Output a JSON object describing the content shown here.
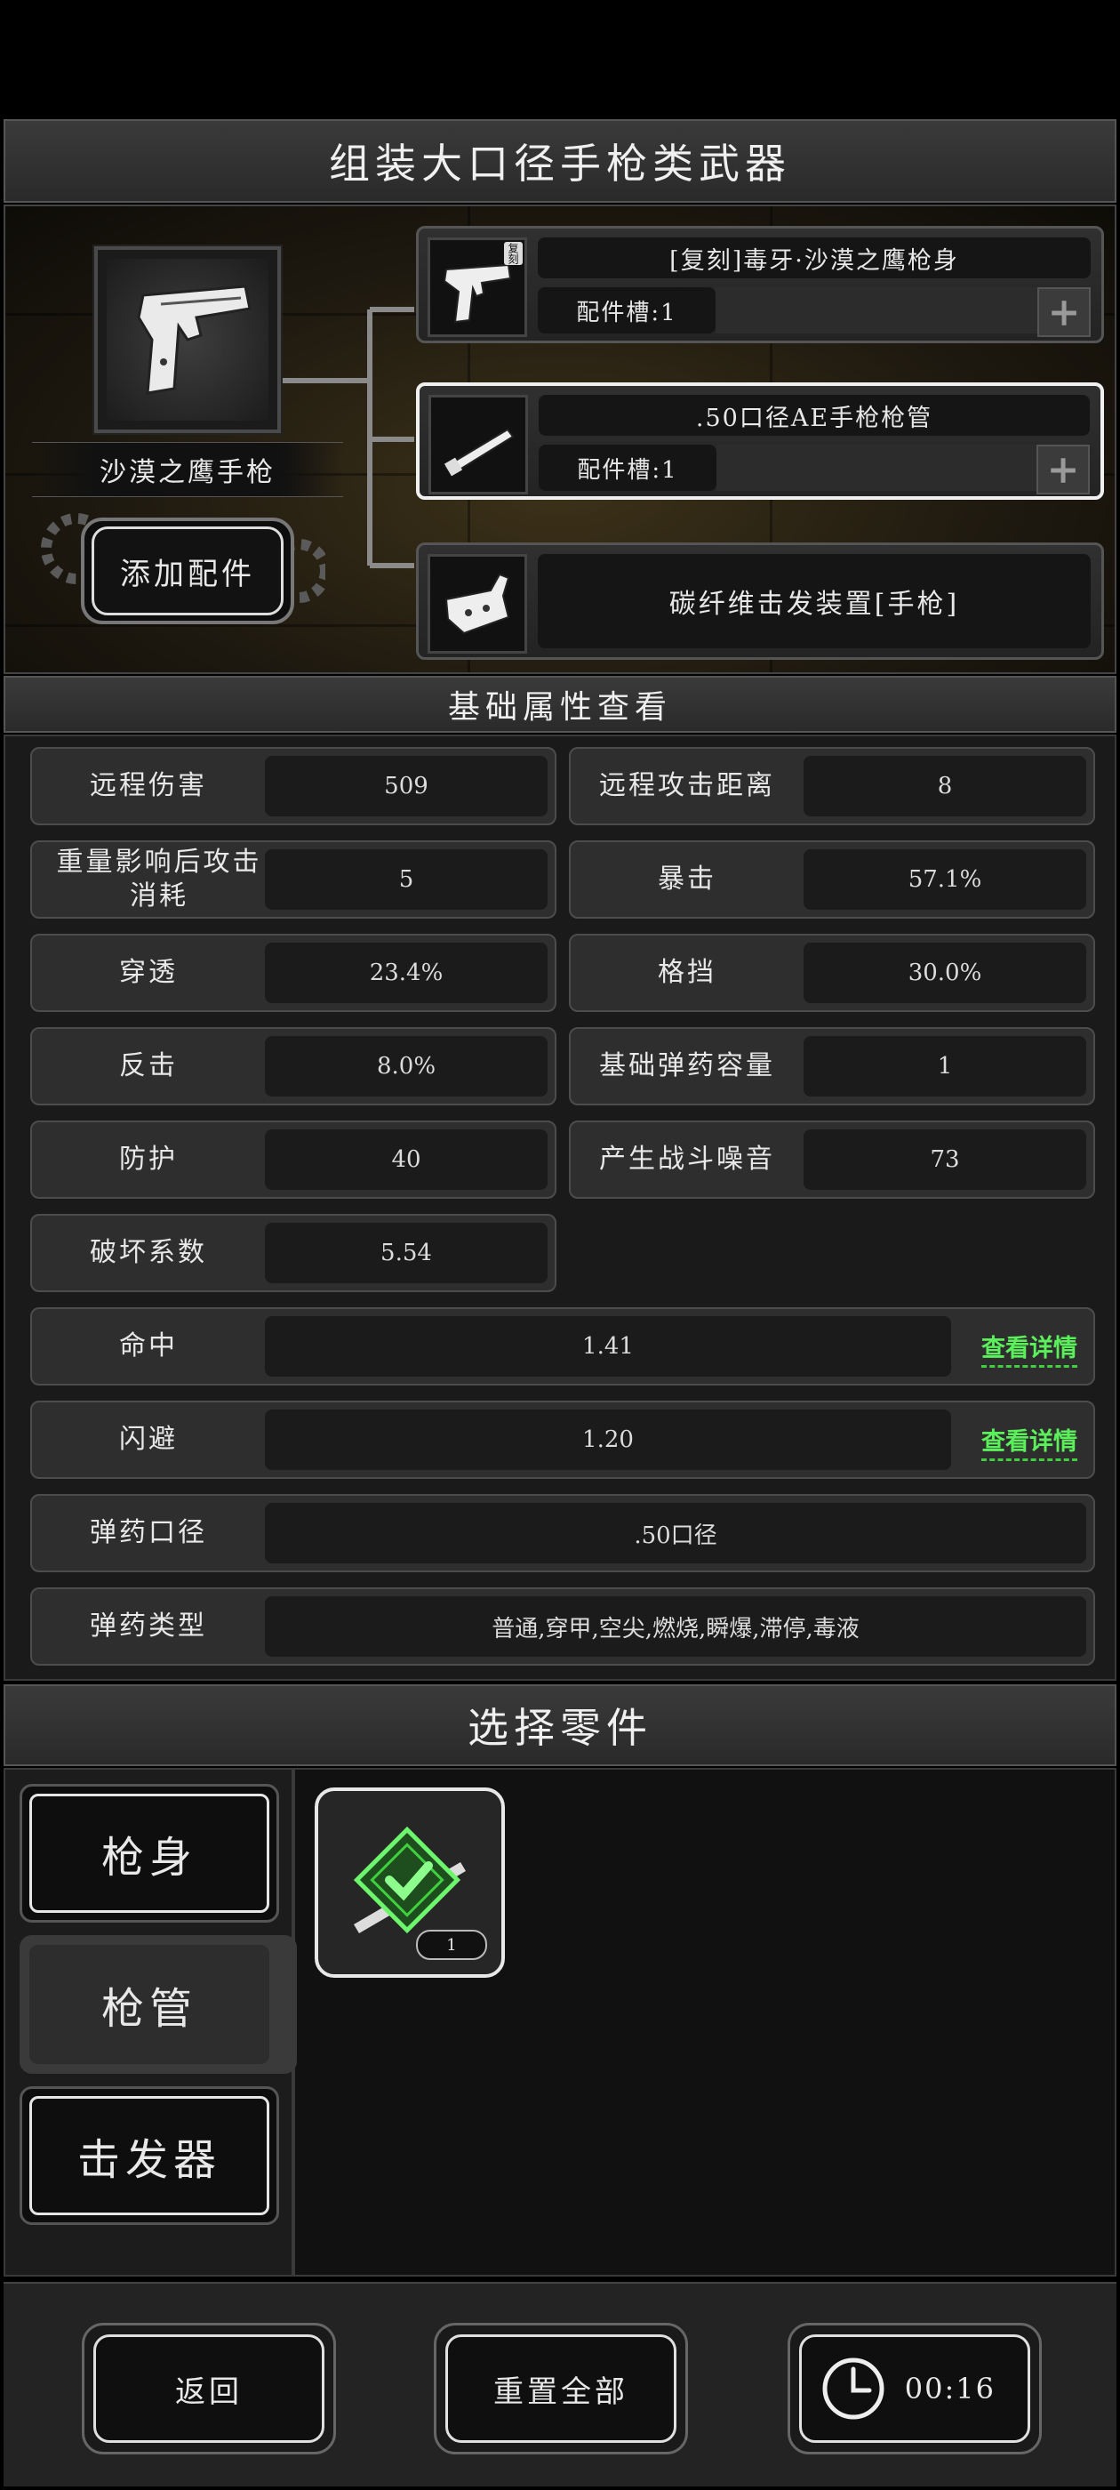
{
  "header": {
    "title": "组装大口径手枪类武器"
  },
  "weapon": {
    "name": "沙漠之鹰手枪",
    "add_button": "添加配件",
    "icon": "pistol-icon"
  },
  "parts": [
    {
      "name": "[复刻]毒牙·沙漠之鹰枪身",
      "slots": "配件槽:1",
      "badge": "复刻",
      "icon": "pistol-frame-icon"
    },
    {
      "name": ".50口径AE手枪枪管",
      "slots": "配件槽:1",
      "icon": "barrel-icon"
    },
    {
      "name": "碳纤维击发装置[手枪]",
      "icon": "trigger-icon"
    }
  ],
  "stats_section": {
    "title": "基础属性查看"
  },
  "stats": {
    "ranged_damage": {
      "label": "远程伤害",
      "value": "509"
    },
    "ranged_distance": {
      "label": "远程攻击距离",
      "value": "8"
    },
    "weight_cost": {
      "label": "重量影响后攻击消耗",
      "value": "5"
    },
    "crit": {
      "label": "暴击",
      "value": "57.1%"
    },
    "penetration": {
      "label": "穿透",
      "value": "23.4%"
    },
    "block": {
      "label": "格挡",
      "value": "30.0%"
    },
    "counter": {
      "label": "反击",
      "value": "8.0%"
    },
    "ammo_capacity": {
      "label": "基础弹药容量",
      "value": "1"
    },
    "defense": {
      "label": "防护",
      "value": "40"
    },
    "noise": {
      "label": "产生战斗噪音",
      "value": "73"
    },
    "destruction": {
      "label": "破坏系数",
      "value": "5.54"
    },
    "hit": {
      "label": "命中",
      "value": "1.41",
      "detail": "查看详情"
    },
    "dodge": {
      "label": "闪避",
      "value": "1.20",
      "detail": "查看详情"
    },
    "caliber": {
      "label": "弹药口径",
      "value": ".50口径"
    },
    "ammo_types": {
      "label": "弹药类型",
      "value": "普通,穿甲,空尖,燃烧,瞬爆,滞停,毒液"
    }
  },
  "select_section": {
    "title": "选择零件"
  },
  "categories": [
    "枪身",
    "枪管",
    "击发器"
  ],
  "active_category": "枪管",
  "selected_item": {
    "count": "1",
    "icon": "equipped-check-icon"
  },
  "footer": {
    "back": "返回",
    "reset": "重置全部",
    "timer": "00:16"
  },
  "colors": {
    "accent_green": "#5bf05b",
    "panel": "#2e2e2e"
  }
}
